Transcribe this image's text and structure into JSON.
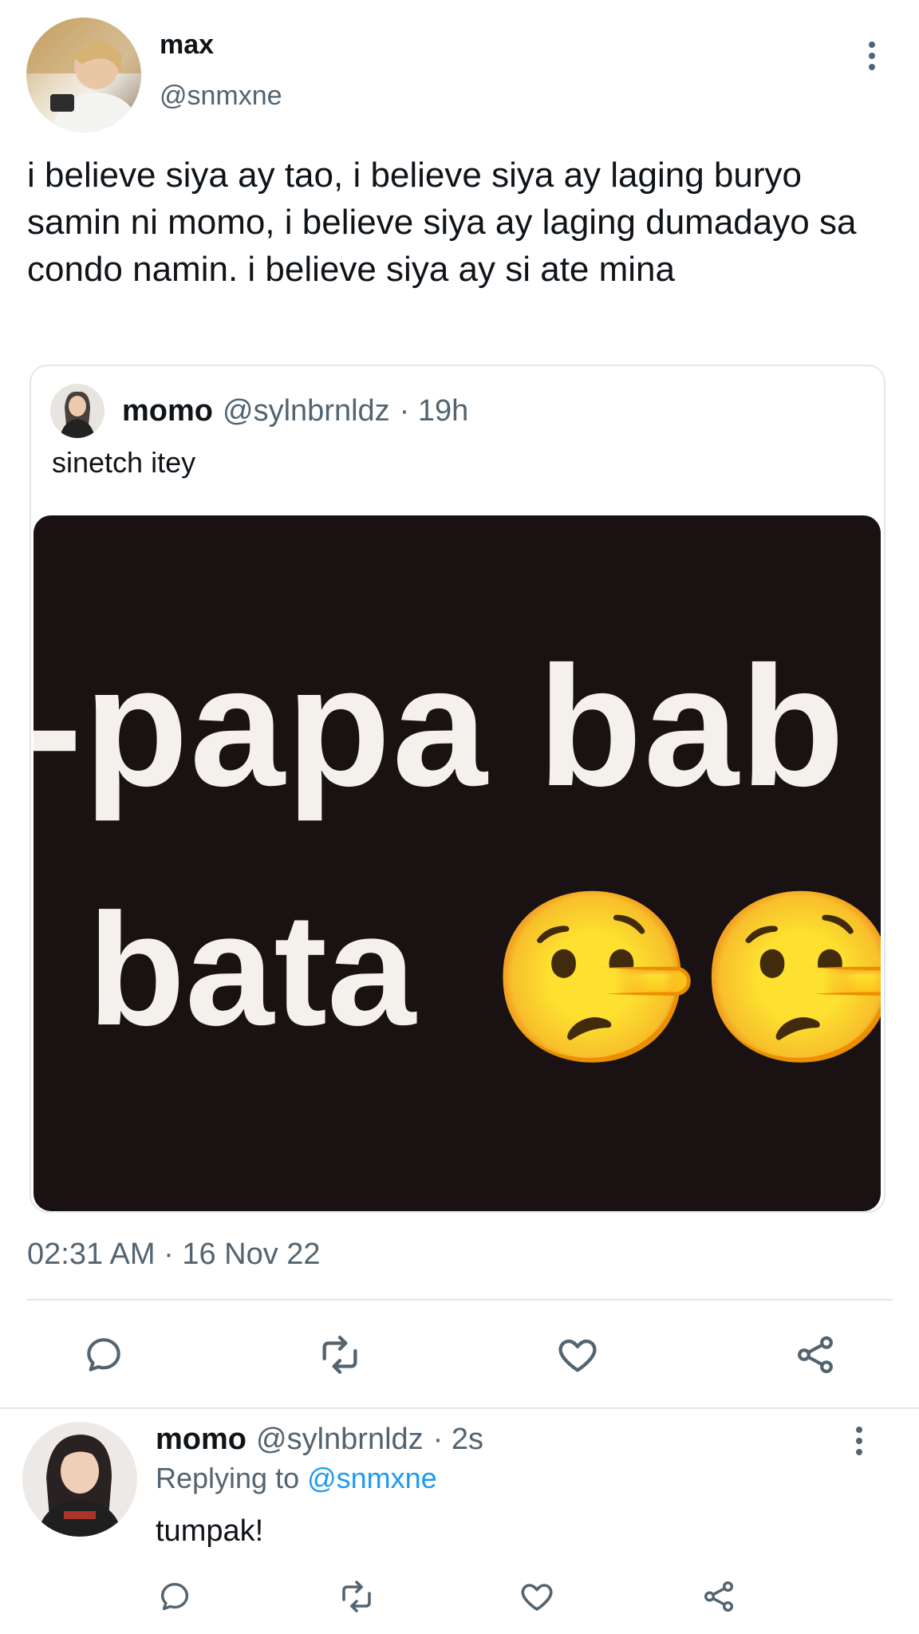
{
  "main_tweet": {
    "author_name": "max",
    "author_handle": "@snmxne",
    "text": "i believe siya ay tao, i believe siya ay laging buryo samin ni momo, i believe siya ay laging dumadayo sa condo namin. i believe siya ay si ate mina",
    "timestamp": "02:31 AM · 16 Nov 22",
    "quoted": {
      "author_name": "momo",
      "author_handle": "@sylnbrnldz",
      "time": "· 19h",
      "text": "sinetch itey",
      "media_text_line1": "-papa bab",
      "media_text_line2": "bata",
      "media_emoji": "🤥🤥"
    }
  },
  "actions": [
    "reply-icon",
    "retweet-icon",
    "like-icon",
    "share-icon"
  ],
  "reply": {
    "author_name": "momo",
    "author_handle": "@sylnbrnldz",
    "time": "· 2s",
    "replying_prefix": "Replying to",
    "replying_handle": "@snmxne",
    "text": "tumpak!"
  },
  "colors": {
    "text": "#0f1419",
    "muted": "#536471",
    "link": "#1d9bf0",
    "divider": "#e1e8ed"
  }
}
